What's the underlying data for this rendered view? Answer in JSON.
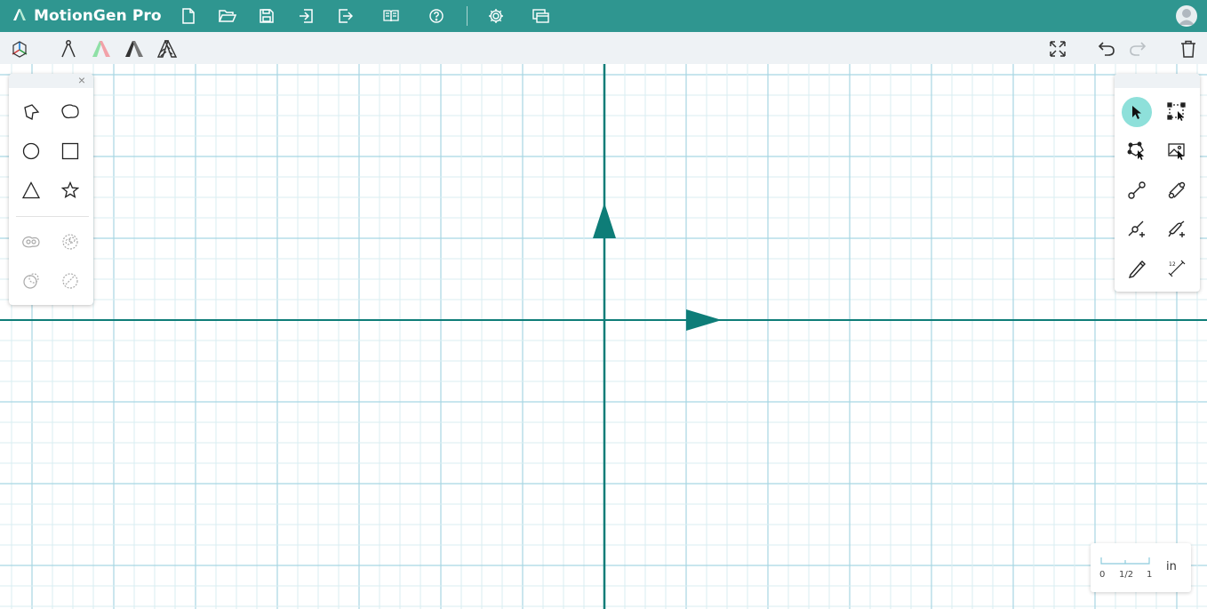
{
  "app": {
    "title": "MotionGen Pro",
    "brand_color": "#2f9690",
    "accent_color": "#0e7d78"
  },
  "topbar": {
    "icons": [
      "file-new-icon",
      "folder-open-icon",
      "save-icon",
      "import-icon",
      "export-icon",
      "book-icon",
      "help-icon",
      "settings-icon",
      "windows-icon"
    ]
  },
  "toolbar2": {
    "left_icons": [
      "axes-3d-icon",
      "compass-icon",
      "linkage-color-icon",
      "linkage-solid-icon",
      "linkage-hatched-icon"
    ],
    "right_icons": [
      "fit-view-icon",
      "undo-icon",
      "redo-icon",
      "trash-icon"
    ]
  },
  "shapes_panel": {
    "close_label": "×",
    "shapes": [
      "polygon-icon",
      "blob-icon",
      "circle-icon",
      "square-icon",
      "triangle-icon",
      "star-icon"
    ],
    "disabled_ops": [
      "union-icon",
      "intersect-icon",
      "subtract-icon",
      "exclude-icon"
    ]
  },
  "tools_panel": {
    "tools": [
      "select-pointer-icon",
      "box-select-icon",
      "node-select-icon",
      "image-select-icon",
      "link-joint-icon",
      "link-bar-icon",
      "add-joint-icon",
      "add-link-icon",
      "pen-icon",
      "measure-icon"
    ],
    "active_tool": "select-pointer-icon"
  },
  "scale": {
    "ticks": [
      "0",
      "1/2",
      "1"
    ],
    "unit": "in"
  },
  "grid": {
    "minor_color": "#d9eef2",
    "major_color": "#a8d6e3",
    "axis_color": "#0e7d78"
  }
}
